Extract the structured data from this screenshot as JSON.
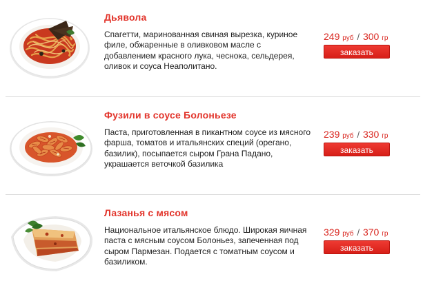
{
  "menu": {
    "items": [
      {
        "title": "Дьявола",
        "description": "Спагетти, маринованная свиная вырезка, куриное филе, обжаренные в оливковом масле с добавлением красного лука, чеснока, сельдерея, оливок и соуса Неаполитано.",
        "price": "249",
        "price_unit": "руб",
        "separator": "/",
        "portion": "300",
        "portion_unit": "гр",
        "button_label": "заказать",
        "photo_icon": "spaghetti-plate-photo"
      },
      {
        "title": "Фузили в соусе Болоньезе",
        "description": "Паста, приготовленная в пикантном соусе из мясного фарша, томатов и итальянских специй (орегано, базилик), посыпается сыром Грана Падано, украшается веточкой базилика",
        "price": "239",
        "price_unit": "руб",
        "separator": "/",
        "portion": "330",
        "portion_unit": "гр",
        "button_label": "заказать",
        "photo_icon": "fusilli-plate-photo"
      },
      {
        "title": "Лазанья с мясом",
        "description": "Национальное итальянское блюдо. Широкая яичная паста с мясным соусом Болоньез, запеченная под сыром Пармезан. Подается с томатным соусом и базиликом.",
        "price": "329",
        "price_unit": "руб",
        "separator": "/",
        "portion": "370",
        "portion_unit": "гр",
        "button_label": "заказать",
        "photo_icon": "lasagna-plate-photo"
      }
    ]
  },
  "colors": {
    "title": "#e2342b",
    "price": "#d9261f",
    "button": "#e12a22",
    "divider": "#dcdcdc"
  }
}
